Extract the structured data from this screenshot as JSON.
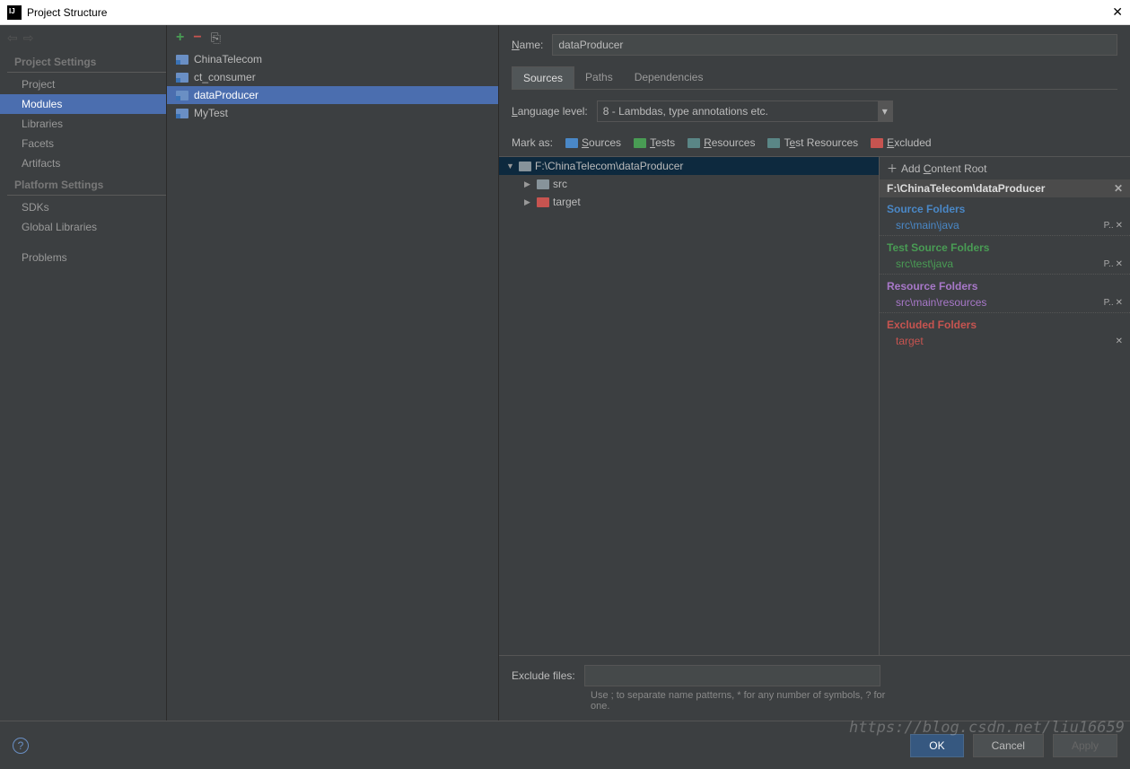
{
  "window": {
    "title": "Project Structure"
  },
  "nav": {
    "section1": "Project Settings",
    "section2": "Platform Settings",
    "items1": [
      "Project",
      "Modules",
      "Libraries",
      "Facets",
      "Artifacts"
    ],
    "items2": [
      "SDKs",
      "Global Libraries"
    ],
    "problems": "Problems"
  },
  "modules": {
    "items": [
      "ChinaTelecom",
      "ct_consumer",
      "dataProducer",
      "MyTest"
    ]
  },
  "content": {
    "nameLabel": "Name:",
    "nameValue": "dataProducer",
    "tabs": [
      "Sources",
      "Paths",
      "Dependencies"
    ],
    "langLabel": "Language level:",
    "langValue": "8 - Lambdas, type annotations etc.",
    "markLabel": "Mark as:",
    "marks": {
      "sources": "Sources",
      "tests": "Tests",
      "resources": "Resources",
      "testres": "Test Resources",
      "excluded": "Excluded"
    },
    "root": "F:\\ChinaTelecom\\dataProducer",
    "treeItems": [
      "src",
      "target"
    ],
    "addContentRoot": "Add Content Root",
    "sbHeader": "F:\\ChinaTelecom\\dataProducer",
    "sections": {
      "source": {
        "title": "Source Folders",
        "item": "src\\main\\java"
      },
      "test": {
        "title": "Test Source Folders",
        "item": "src\\test\\java"
      },
      "resource": {
        "title": "Resource Folders",
        "item": "src\\main\\resources"
      },
      "excluded": {
        "title": "Excluded Folders",
        "item": "target"
      }
    },
    "excludeLabel": "Exclude files:",
    "excludeHint": "Use ; to separate name patterns, * for any number of symbols, ? for one."
  },
  "footer": {
    "ok": "OK",
    "cancel": "Cancel",
    "apply": "Apply"
  },
  "watermark": "https://blog.csdn.net/liu16659"
}
